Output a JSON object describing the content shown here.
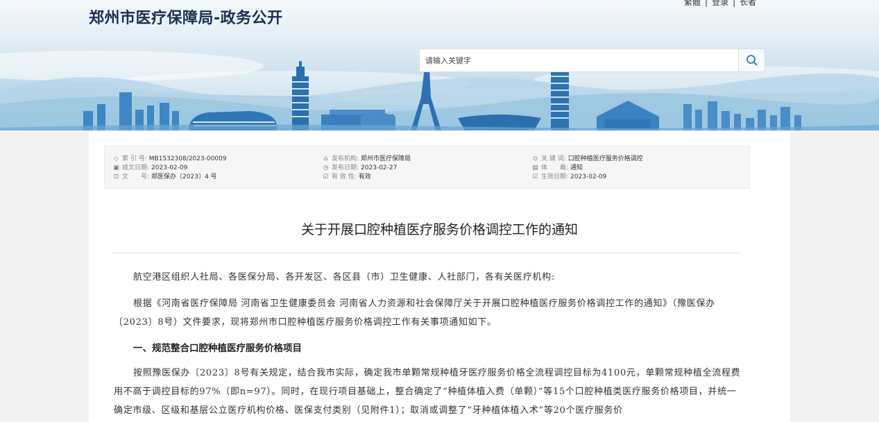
{
  "header": {
    "site_title": "郑州市医疗保障局-政务公开",
    "top_links": [
      "繁體",
      "登录",
      "长者"
    ],
    "search_placeholder": "请输入关键字"
  },
  "meta": {
    "col1": [
      {
        "icon": "tag-icon",
        "label": "索 引 号:",
        "value": "MB1532308/2023-00009"
      },
      {
        "icon": "calendar-icon",
        "label": "成文日期:",
        "value": "2023-02-09"
      },
      {
        "icon": "document-icon",
        "label": "文　　号:",
        "value": "郑医保办〔2023〕4 号"
      }
    ],
    "col2": [
      {
        "icon": "bank-icon",
        "label": "发布机构:",
        "value": "郑州市医疗保障局"
      },
      {
        "icon": "clock-icon",
        "label": "发布日期:",
        "value": "2023-02-27"
      },
      {
        "icon": "check-icon",
        "label": "有 效 性:",
        "value": "有效"
      }
    ],
    "col3": [
      {
        "icon": "key-icon",
        "label": "关 键 词:",
        "value": "口腔种植医疗服务价格调控"
      },
      {
        "icon": "genre-icon",
        "label": "体　　裁:",
        "value": "通知"
      },
      {
        "icon": "effect-icon",
        "label": "生效日期:",
        "value": "2023-02-09"
      }
    ]
  },
  "article": {
    "title": "关于开展口腔种植医疗服务价格调控工作的通知",
    "salutation": "航空港区组织人社局、各医保分局、各开发区、各区县（市）卫生健康、人社部门，各有关医疗机构:",
    "para1": "根据《河南省医疗保障局 河南省卫生健康委员会 河南省人力资源和社会保障厅关于开展口腔种植医疗服务价格调控工作的通知》（豫医保办〔2023〕8号）文件要求，现将郑州市口腔种植医疗服务价格调控工作有关事项通知如下。",
    "heading1": "一、规范整合口腔种植医疗服务价格项目",
    "para2": "按照豫医保办〔2023〕8号有关规定，结合我市实际，确定我市单颗常规种植牙医疗服务价格全流程调控目标为4100元，单颗常规种植全流程费用不高于调控目标的97%（即n=97）。同时，在现行项目基础上，整合确定了“种植体植入费（单颗）”等15个口腔种植类医疗服务价格项目，并统一确定市级、区级和基层公立医疗机构价格、医保支付类别（见附件1）；取消或调整了“牙种植体植入术”等20个医疗服务价"
  }
}
